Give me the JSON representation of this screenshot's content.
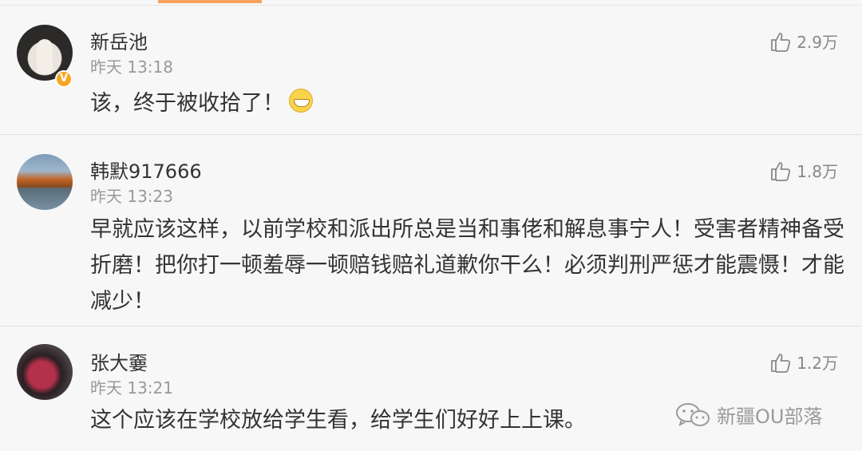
{
  "comments": [
    {
      "username": "新岳池",
      "time": "昨天 13:18",
      "text": "该，终于被收拾了！",
      "likes": "2.9万",
      "verified": true,
      "emoji": "grin-emoji"
    },
    {
      "username": "韩默917666",
      "time": "昨天 13:23",
      "text": "早就应该这样，以前学校和派出所总是当和事佬和解息事宁人！受害者精神备受折磨！把你打一顿羞辱一顿赔钱赔礼道歉你干么！必须判刑严惩才能震慑！才能减少！",
      "likes": "1.8万"
    },
    {
      "username": "张大嫑",
      "time": "昨天 13:21",
      "text": "这个应该在学校放给学生看，给学生们好好上上课。",
      "likes": "1.2万"
    }
  ],
  "watermark": {
    "text": "新疆OU部落",
    "icon": "wechat-icon"
  },
  "colors": {
    "accent": "#f5a25d",
    "verified": "#f5a623",
    "text": "#333333",
    "muted": "#999999"
  }
}
